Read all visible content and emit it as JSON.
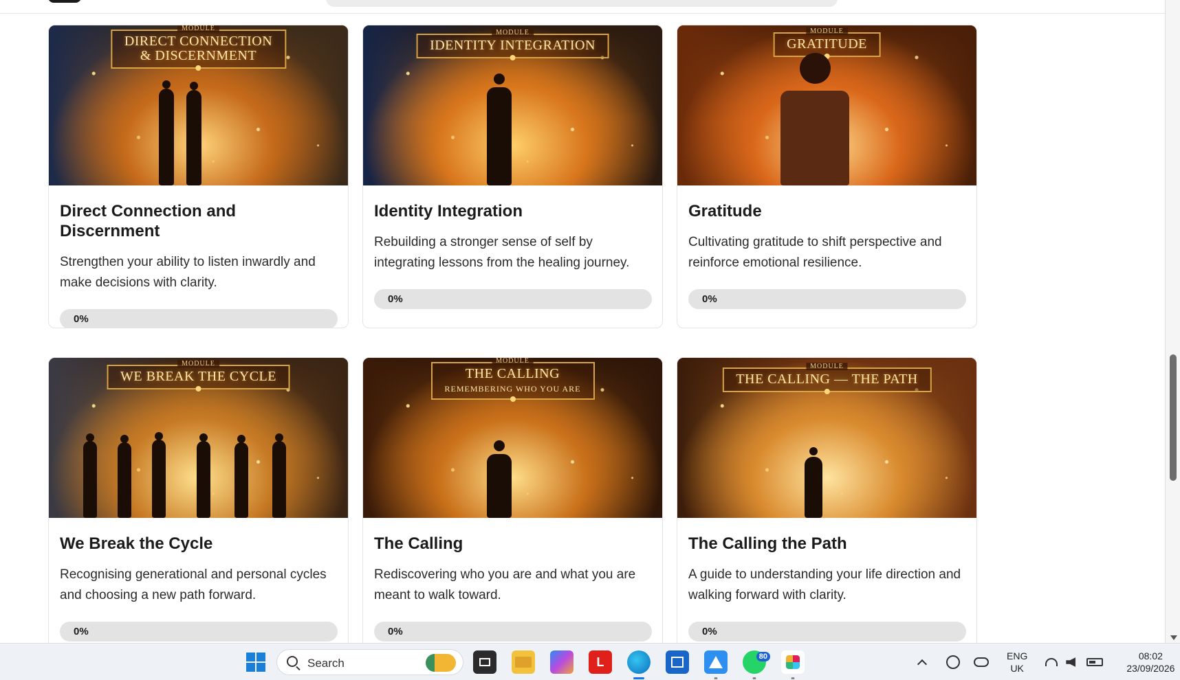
{
  "modules": [
    {
      "banner_kicker": "MODULE",
      "banner_title": "DIRECT CONNECTION\n& DISCERNMENT",
      "banner_sub": "",
      "title": "Direct Connection and Discernment",
      "description": "Strengthen your ability to listen inwardly and make decisions with clarity.",
      "progress": 0,
      "progress_label": "0%",
      "theme": {
        "top": "#3b2a1a",
        "mid": "#c56a1a",
        "glow": "#ffd37a",
        "left": "#1c2a4a"
      }
    },
    {
      "banner_kicker": "MODULE",
      "banner_title": "IDENTITY INTEGRATION",
      "banner_sub": "",
      "title": "Identity Integration",
      "description": "Rebuilding a stronger sense of self by integrating lessons from the healing journey.",
      "progress": 0,
      "progress_label": "0%",
      "theme": {
        "top": "#2a1a10",
        "mid": "#d8761c",
        "glow": "#ffcf6b",
        "left": "#152447"
      }
    },
    {
      "banner_kicker": "MODULE",
      "banner_title": "GRATITUDE",
      "banner_sub": "",
      "title": "Gratitude",
      "description": "Cultivating gratitude to shift perspective and reinforce emotional resilience.",
      "progress": 0,
      "progress_label": "0%",
      "theme": {
        "top": "#4a1f08",
        "mid": "#d9671a",
        "glow": "#ffd98a",
        "left": "#6a2a0a"
      }
    },
    {
      "banner_kicker": "MODULE",
      "banner_title": "WE BREAK THE CYCLE",
      "banner_sub": "",
      "title": "We Break the Cycle",
      "description": "Recognising generational and personal cycles and choosing a new path forward.",
      "progress": 0,
      "progress_label": "0%",
      "theme": {
        "top": "#3a2414",
        "mid": "#c77a24",
        "glow": "#ffe08e",
        "left": "#3a3a44"
      }
    },
    {
      "banner_kicker": "MODULE",
      "banner_title": "THE CALLING",
      "banner_sub": "REMEMBERING WHO YOU ARE",
      "title": "The Calling",
      "description": "Rediscovering who you are and what you are meant to walk toward.",
      "progress": 0,
      "progress_label": "0%",
      "theme": {
        "top": "#2e1608",
        "mid": "#c9701a",
        "glow": "#ffde8a",
        "left": "#3a1a08"
      }
    },
    {
      "banner_kicker": "MODULE",
      "banner_title": "THE CALLING — THE PATH",
      "banner_sub": "",
      "title": "The Calling the Path",
      "description": "A guide to understanding your life direction and walking forward with clarity.",
      "progress": 0,
      "progress_label": "0%",
      "theme": {
        "top": "#6a3010",
        "mid": "#d98a2e",
        "glow": "#ffe4a0",
        "left": "#3a1c0a"
      }
    }
  ],
  "taskbar": {
    "search_placeholder": "Search",
    "apps": [
      {
        "name": "task-view",
        "icon": "task-view-icon"
      },
      {
        "name": "file-explorer",
        "icon": "folder-icon"
      },
      {
        "name": "copilot",
        "icon": "copilot-icon"
      },
      {
        "name": "l-app",
        "icon": "l-app-icon",
        "label": "L"
      },
      {
        "name": "edge",
        "icon": "edge-icon"
      },
      {
        "name": "store",
        "icon": "store-icon"
      },
      {
        "name": "a-app",
        "icon": "a-app-icon"
      },
      {
        "name": "whatsapp",
        "icon": "whatsapp-icon",
        "badge": "80"
      },
      {
        "name": "slack",
        "icon": "slack-icon"
      }
    ],
    "language_line1": "ENG",
    "language_line2": "UK",
    "time": "08:02",
    "date": "23/09/2026"
  }
}
